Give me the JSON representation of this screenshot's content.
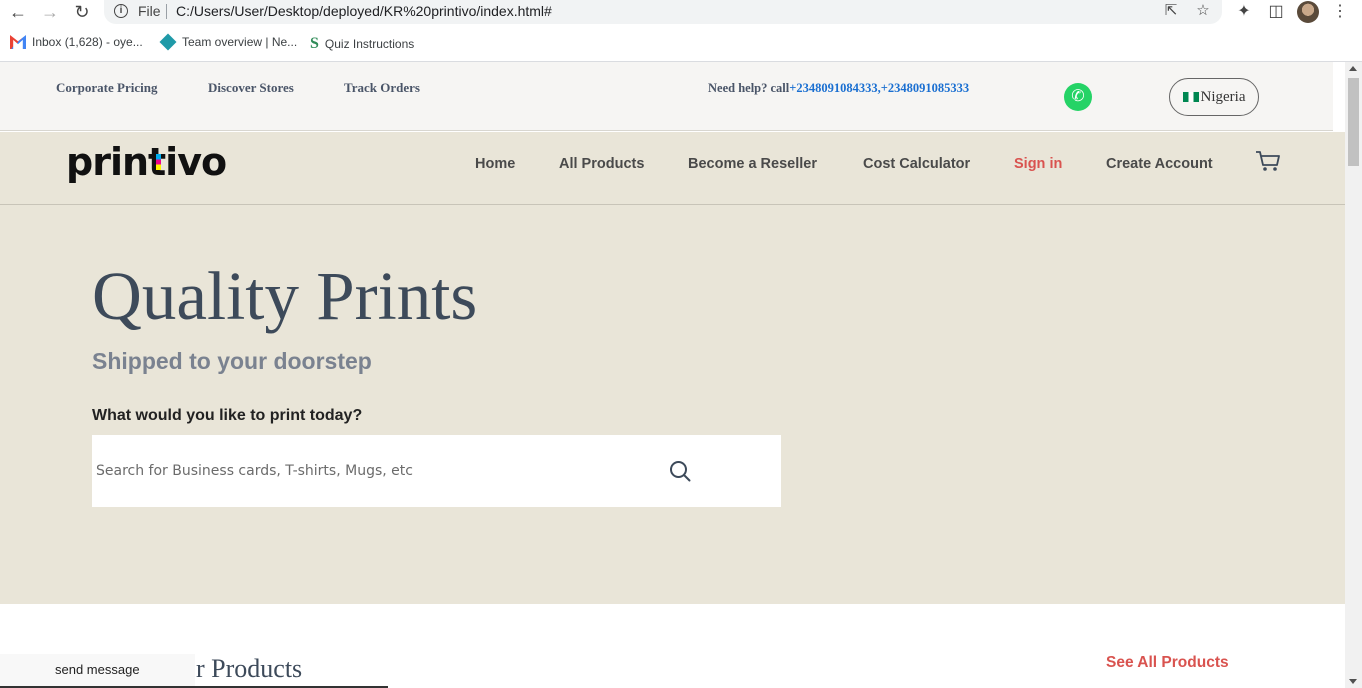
{
  "browser": {
    "tab_info": "File",
    "url": "C:/Users/User/Desktop/deployed/KR%20printivo/index.html#",
    "bookmarks": [
      {
        "label": "Inbox (1,628) - oye..."
      },
      {
        "label": "Team overview | Ne..."
      },
      {
        "label": "Quiz Instructions"
      }
    ]
  },
  "topbar": {
    "links": [
      "Corporate Pricing",
      "Discover Stores",
      "Track Orders"
    ],
    "help_label": "Need help? call",
    "help_phones": "+2348091084333,+2348091085333",
    "country": "Nigeria"
  },
  "nav": {
    "logo": "printivo",
    "items": [
      "Home",
      "All Products",
      "Become a Reseller",
      "Cost Calculator",
      "Sign in",
      "Create Account"
    ]
  },
  "hero": {
    "title": "Quality Prints",
    "subtitle": "Shipped to your doorstep",
    "question": "What would you like to print today?",
    "search_placeholder": "Search for Business cards, T-shirts, Mugs, etc"
  },
  "products": {
    "title_fragment": "r Products",
    "see_all": "See All Products"
  },
  "chat": {
    "label": "send message"
  },
  "colors": {
    "accent": "#d9534f",
    "hero_bg": "#e9e5d8",
    "phone_link": "#1a6fd1"
  }
}
